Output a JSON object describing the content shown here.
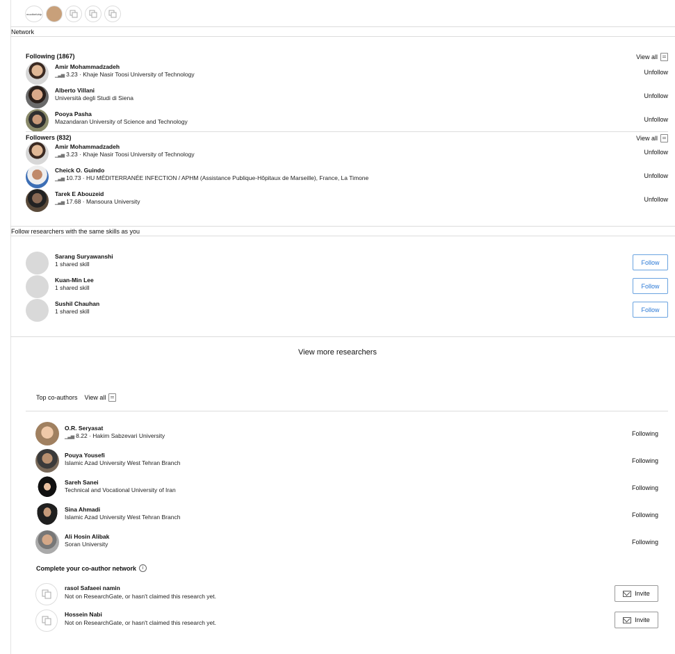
{
  "topbar": {
    "logo_text": "moothefuhip",
    "icons": [
      "avatar-icon",
      "copy-icon",
      "copy-icon",
      "copy-icon"
    ]
  },
  "network": {
    "label": "Network",
    "following": {
      "title": "Following (1867)",
      "view_all": "View all",
      "people": [
        {
          "name": "Amir Mohammadzadeh",
          "score": "3.23",
          "info": " · Khaje Nasir Toosi University of Technology",
          "action": "Unfollow"
        },
        {
          "name": "Alberto Villani",
          "score": null,
          "info": "Università degli Studi di Siena",
          "action": "Unfollow"
        },
        {
          "name": "Pooya Pasha",
          "score": null,
          "info": "Mazandaran University of Science and Technology",
          "action": "Unfollow"
        }
      ]
    },
    "followers": {
      "title": "Followers (832)",
      "view_all": "View all",
      "people": [
        {
          "name": "Amir Mohammadzadeh",
          "score": "3.23",
          "info": " · Khaje Nasir Toosi University of Technology",
          "action": "Unfollow"
        },
        {
          "name": "Cheick O. Guindo",
          "score": "10.73",
          "info": " · HU MÉDITERRANÉE INFECTION / APHM (Assistance Publique-Hôpitaux de Marseille), France, La Timone",
          "action": "Unfollow"
        },
        {
          "name": "Tarek E Abouzeid",
          "score": "17.68",
          "info": " · Mansoura University",
          "action": "Unfollow"
        }
      ]
    }
  },
  "suggestions": {
    "label": "Follow researchers with the same skills as you",
    "people": [
      {
        "name": "Sarang Suryawanshi",
        "info": "1 shared skill",
        "action": "Follow"
      },
      {
        "name": "Kuan-Min Lee",
        "info": "1 shared skill",
        "action": "Follow"
      },
      {
        "name": "Sushil Chauhan",
        "info": "1 shared skill",
        "action": "Follow"
      }
    ],
    "view_more": "View more researchers"
  },
  "coauthors": {
    "title": "Top co-authors",
    "view_all": "View all",
    "people": [
      {
        "name": "O.R. Seryasat",
        "score": "8.22",
        "info": " · Hakim Sabzevari University",
        "action": "Following"
      },
      {
        "name": "Pouya Yousefi",
        "score": null,
        "info": "Islamic Azad University West Tehran Branch",
        "action": "Following"
      },
      {
        "name": "Sareh Sanei",
        "score": null,
        "info": "Technical and Vocational University of Iran",
        "action": "Following"
      },
      {
        "name": "Sina Ahmadi",
        "score": null,
        "info": "Islamic Azad University West Tehran Branch",
        "action": "Following"
      },
      {
        "name": "Ali Hosin Alibak",
        "score": null,
        "info": "Soran University",
        "action": "Following"
      }
    ],
    "complete_title": "Complete your co-author network",
    "invites": [
      {
        "name": "rasol Safaeei namin",
        "info": "Not on ResearchGate, or hasn't claimed this research yet.",
        "action": "Invite"
      },
      {
        "name": "Hossein Nabi",
        "info": "Not on ResearchGate, or hasn't claimed this research yet.",
        "action": "Invite"
      }
    ]
  },
  "colors": {
    "accent": "#2a78d6",
    "divider": "#dcdcdc",
    "placeholder_avatar": "#d9d9d9"
  }
}
